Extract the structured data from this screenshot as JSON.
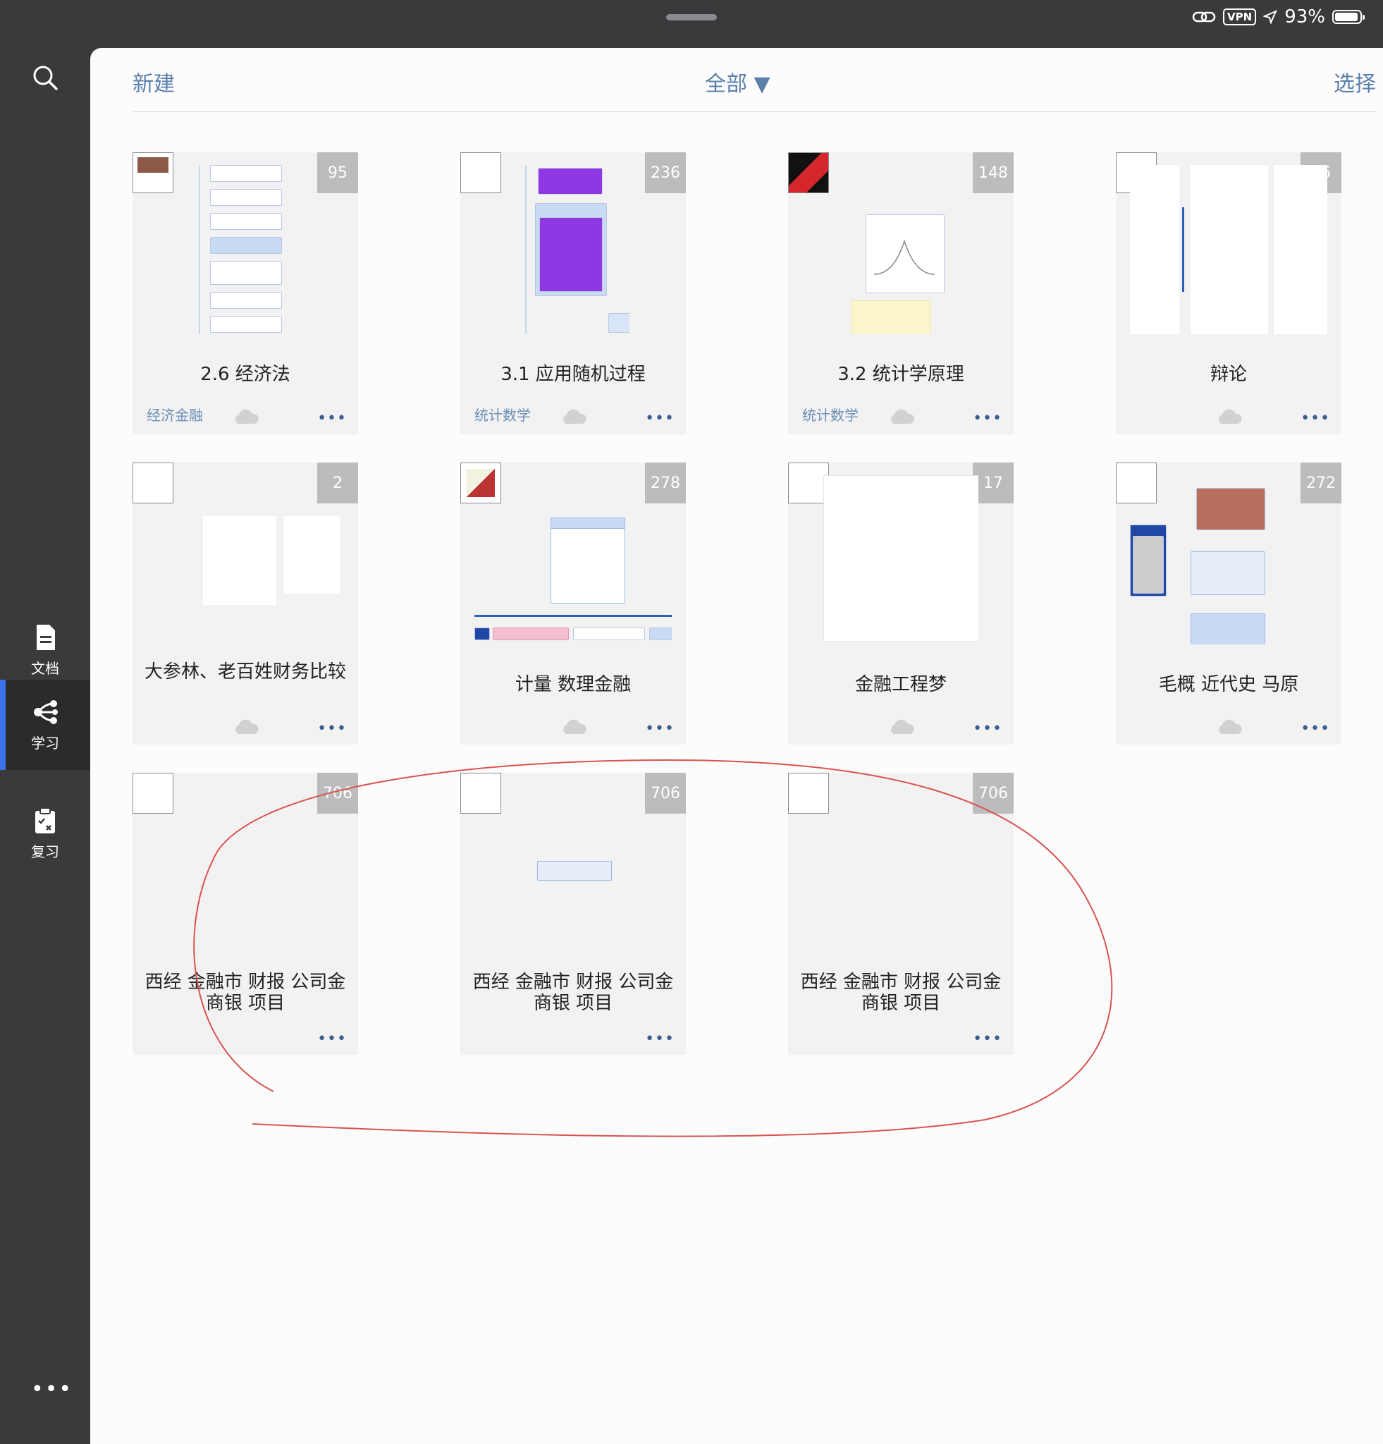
{
  "status_bar": {
    "battery": "93%",
    "vpn": "VPN"
  },
  "sidebar": {
    "items": [
      {
        "label": "文档"
      },
      {
        "label": "学习"
      },
      {
        "label": "复习"
      }
    ],
    "more": "•••"
  },
  "topbar": {
    "new_label": "新建",
    "filter_label": "全部 ▼",
    "select_label": "选择"
  },
  "cards": [
    {
      "title": "2.6 经济法",
      "count": "95",
      "tag": "经济金融"
    },
    {
      "title": "3.1 应用随机过程",
      "count": "236",
      "tag": "统计数学"
    },
    {
      "title": "3.2 统计学原理",
      "count": "148",
      "tag": "统计数学"
    },
    {
      "title": "辩论",
      "count": "56",
      "tag": ""
    },
    {
      "title": "大参林、老百姓财务比较",
      "count": "2",
      "tag": ""
    },
    {
      "title": "计量 数理金融",
      "count": "278",
      "tag": ""
    },
    {
      "title": "金融工程梦",
      "count": "17",
      "tag": ""
    },
    {
      "title": "毛概 近代史 马原",
      "count": "272",
      "tag": ""
    },
    {
      "title": "西经 金融市 财报 公司金 商银 项目",
      "count": "706",
      "tag": ""
    },
    {
      "title": "西经 金融市 财报 公司金 商银 项目",
      "count": "706",
      "tag": ""
    },
    {
      "title": "西经 金融市 财报 公司金 商银 项目",
      "count": "706",
      "tag": ""
    }
  ],
  "card_more": "•••"
}
